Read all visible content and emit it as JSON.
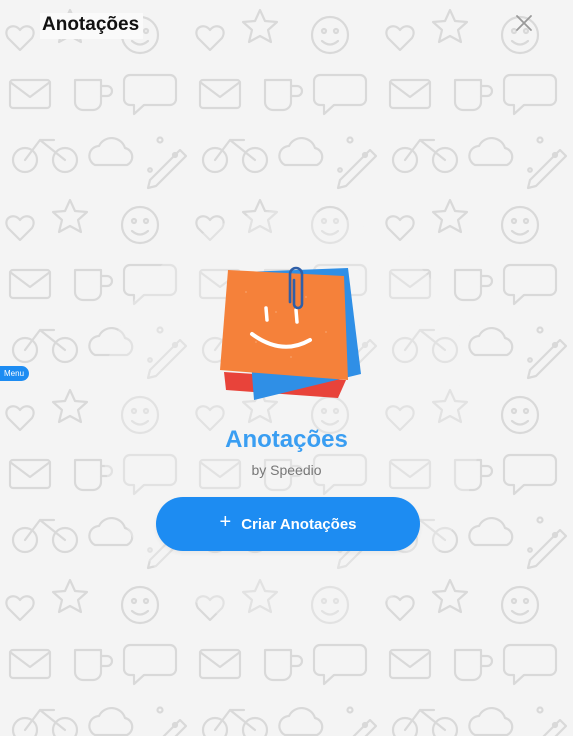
{
  "header": {
    "title": "Anotações",
    "close_icon": "close-icon"
  },
  "side_tab": {
    "label": "Menu"
  },
  "app": {
    "name": "Anotações",
    "by": "by Speedio",
    "logo_icon": "sticky-notes-smile-icon"
  },
  "actions": {
    "create_label": "Criar Anotações",
    "create_icon": "plus-icon"
  },
  "colors": {
    "accent": "#1d8cf2",
    "title_accent": "#3a9ef2",
    "note_orange": "#f5813a",
    "note_blue": "#2f8fe6",
    "note_red": "#e8433a"
  }
}
